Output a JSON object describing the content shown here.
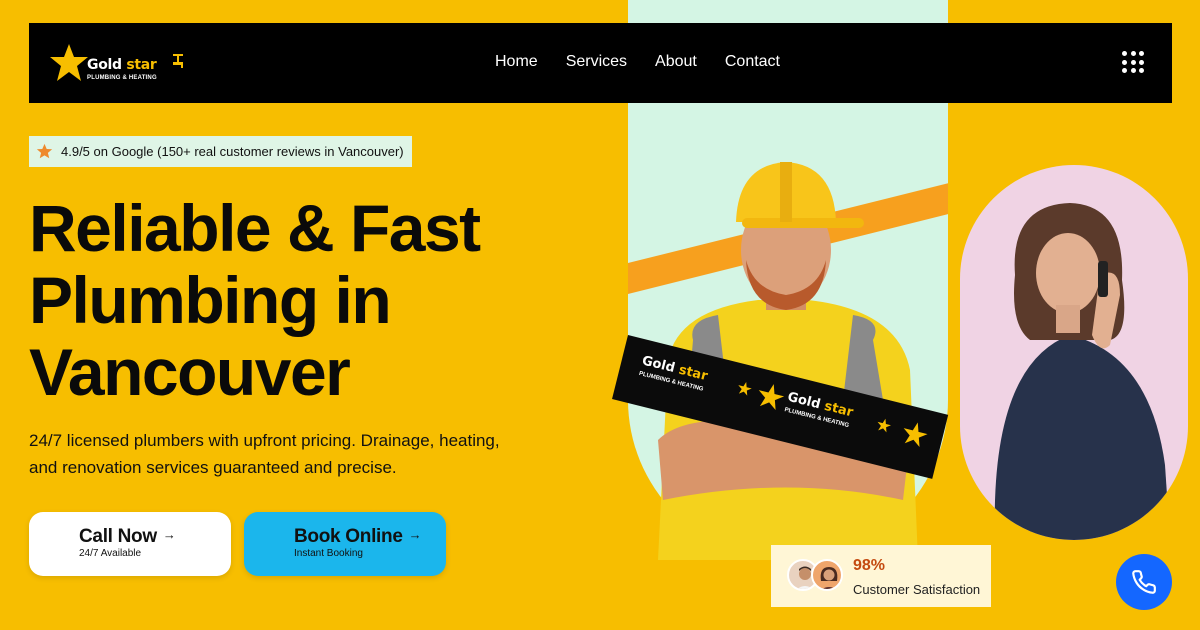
{
  "brand": {
    "name_part1": "Gold",
    "name_part2": "star",
    "tagline": "PLUMBING & HEATING"
  },
  "nav": {
    "items": [
      {
        "label": "Home"
      },
      {
        "label": "Services"
      },
      {
        "label": "About"
      },
      {
        "label": "Contact"
      }
    ],
    "menu_icon": "grid-menu-icon"
  },
  "rating": {
    "icon": "star-icon",
    "text": "4.9/5 on Google (150+ real customer reviews in Vancouver)"
  },
  "hero": {
    "headline_lines": [
      "Reliable & Fast",
      "Plumbing in",
      "Vancouver"
    ],
    "description": "24/7 licensed plumbers with upfront pricing. Drainage, heating, and renovation services guaranteed and precise."
  },
  "buttons": {
    "call": {
      "label": "Call Now",
      "sub": "24/7 Available",
      "icon": "arrow-right-icon"
    },
    "book": {
      "label": "Book Online",
      "sub": "Instant Booking",
      "icon": "arrow-right-icon"
    }
  },
  "satisfaction": {
    "value": "98%",
    "label": "Customer Satisfaction"
  },
  "floating_action": {
    "icon": "phone-icon"
  },
  "colors": {
    "background": "#F7BE00",
    "nav": "#000000",
    "accent_blue": "#1BB6EC",
    "phone_blue": "#1467FF",
    "mint": "#D4F5E4",
    "pink": "#F0D3E4"
  }
}
